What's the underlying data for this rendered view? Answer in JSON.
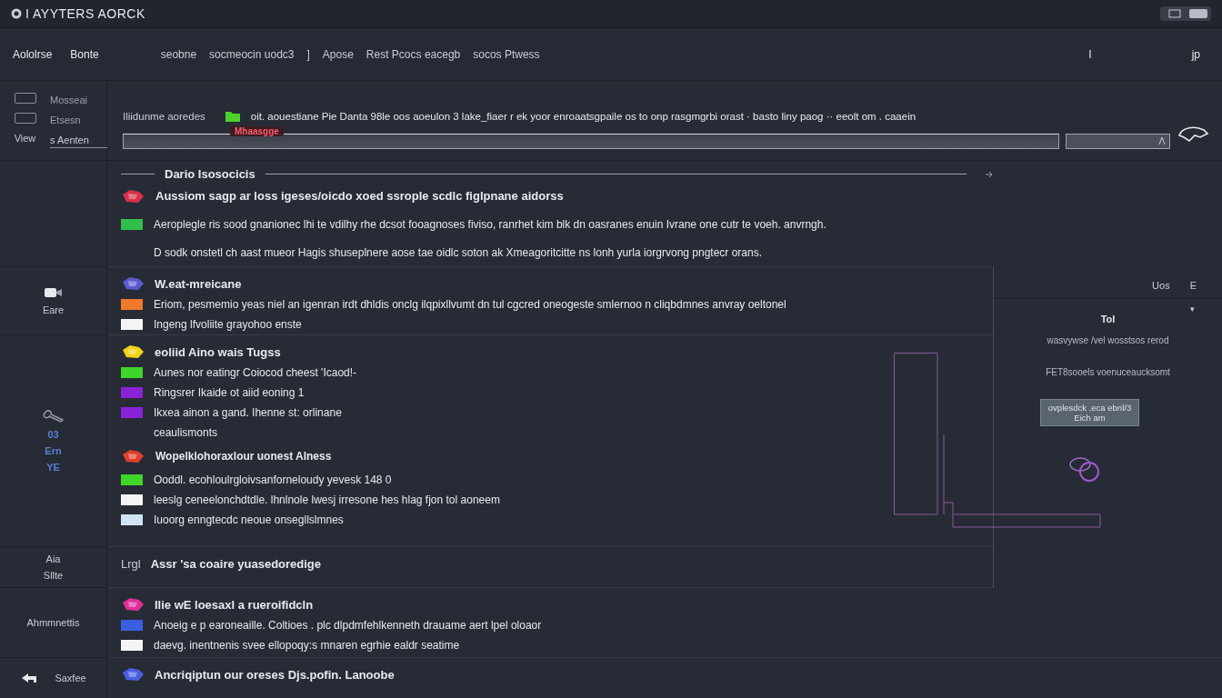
{
  "window": {
    "title": "I AYYTERS AORCK"
  },
  "nav": {
    "left": [
      "Aololrse",
      "Bonte"
    ],
    "menu": [
      "seobne",
      "socmeocin uodc3",
      "]",
      "Apose",
      "Rest Pcocs eacegb",
      "socos Ptwess"
    ],
    "right": [
      "I",
      "jp"
    ]
  },
  "sidebar": {
    "items": [
      {
        "label": "Mosseai",
        "selected": false
      },
      {
        "label": "Etsesn",
        "selected": false
      },
      {
        "label": "s Aenten",
        "selected": true
      }
    ],
    "view_label": "View"
  },
  "search": {
    "label": "Iliidunme aoredes",
    "description": "oit. aouestiane Pie Danta 98le oos aoeulon 3 lake_fiaer r ek yoor enroaatsgpaile os to onp rasgmgrbi orast · basto liny paog ·· eeolt om . caaein",
    "tag": "Mhaasgge"
  },
  "sections": [
    {
      "kind": "ruled",
      "title": "Dario Isosocicis",
      "items": [
        {
          "kind": "strong",
          "color": "#d8324a",
          "text": "Aussiom sagp ar loss igeses/oicdo xoed ssrople scdlc figlpnane aidorss"
        },
        {
          "kind": "normal",
          "color": "#2fbf4a",
          "text": "Aeroplegle ris sood gnanionec lhi te vdilhy rhe dcsot fooagnoses fiviso, ranrhet kim blk dn oasranes enuin Ivrane one cutr te voeh. anvrngh."
        },
        {
          "kind": "normal",
          "text": "D sodk onstetl ch aast mueor Hagis shuseplnere aose tae oidlc soton ak Xmeagoritcitte ns lonh yurla iorgrvong pngtecr orans."
        }
      ]
    },
    {
      "kind": "icon",
      "title": "W.eat-mreicane",
      "color": "#5a5ad0",
      "side": [
        "Eare"
      ],
      "items": [
        {
          "kind": "normal",
          "color": "#f07a2a",
          "text": "Eriom, pesmemio yeas niel an igenran irdt dhldis onclg ilqpixllvumt dn tul cgcred oneogeste smlernoo n cliqbdmnes anvray oeltonel"
        },
        {
          "kind": "normal",
          "color": "#f4f4f4",
          "text": "Ingeng lfvoliite grayohoo enste"
        }
      ]
    },
    {
      "kind": "icon",
      "title": "eoliid Aino wais Tugss",
      "color": "#f2d21a",
      "side": [
        "03",
        "Ern",
        "YE"
      ],
      "items": [
        {
          "kind": "normal",
          "color": "#3fd62a",
          "text": "Aunes nor eatingr Coiocod cheest 'Icaod!-"
        },
        {
          "kind": "normal",
          "color": "#8a22d8",
          "text": "Ringsrer Ikaide ot aiid eoning 1"
        },
        {
          "kind": "normal",
          "color": "#8a22d8",
          "text": "Ikxea ainon a gand. Ihenne st: orlinane"
        },
        {
          "kind": "normal",
          "text": "ceaulismonts"
        },
        {
          "kind": "heading",
          "color": "#e0402a",
          "text": "Wopelklohoraxlour uonest Alness"
        },
        {
          "kind": "normal",
          "color": "#3fd62a",
          "text": "Ooddl. ecohloulrgloivsanforneloudy yevesk 148 0"
        },
        {
          "kind": "normal",
          "color": "#f4f4f4",
          "text": "leeslg ceneelonchdtdle. lhnlnole lwesj irresone hes hlag fjon tol aoneem"
        },
        {
          "kind": "normal",
          "color": "#cfe4f4",
          "text": "Iuoorg enngtecdc neoue onsegllslmnes"
        }
      ]
    },
    {
      "kind": "plain",
      "prefix": "Lrgl",
      "title": "Assr 'sa coaire yuasedoredige",
      "side": [
        "Aia",
        "Sllte"
      ]
    },
    {
      "kind": "icon",
      "title": "Ilie wE loesaxl a rueroifidcln",
      "color": "#e0309a",
      "side": [
        "Ahmmnettis"
      ],
      "items": [
        {
          "kind": "normal",
          "color": "#3a5ee0",
          "text": "Anoeig e p earoneaille. Coltioes . plc dlpdmfehlkenneth drauame aert lpel oloaor"
        },
        {
          "kind": "normal",
          "color": "#f4f4f4",
          "text": "daevg. inentnenis svee ellopoqy:s mnaren egrhie ealdr seatime"
        }
      ]
    },
    {
      "kind": "icon",
      "title": "Ancriqiptun our oreses Djs.pofin. Lanoobe",
      "color": "#4a5ee0",
      "side": [
        "Saxfee"
      ]
    }
  ],
  "panel": {
    "header": [
      "Uos",
      "E"
    ],
    "caret": "▾",
    "title": "Tol",
    "lines": [
      "wasvywse /vel wosstsos rerod",
      "FET8sooels voenuceaucksomt"
    ],
    "button": [
      "ovplesdck .eca ebnl/3",
      "Eich am"
    ]
  }
}
